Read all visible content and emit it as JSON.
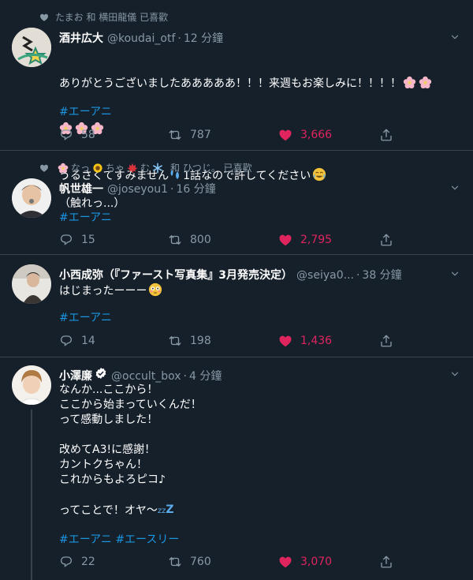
{
  "tweets": [
    {
      "social": "たまお 和 横田龍儀 已喜歡",
      "name": "酒井広大",
      "handle": "@koudai_otf",
      "time": "12 分鐘",
      "lines": [
        "ありがとうございましたあああああ！！！来週もお楽しみに！！！！",
        "",
        "うるさくてすみません",
        "1話なので許してください"
      ],
      "hashtags": "#エーアニ",
      "reply": "58",
      "retweet": "787",
      "like": "3,666"
    },
    {
      "social_a": "なっ",
      "social_b": "ちゃ",
      "social_c": "む",
      "social_d": "和 ひつじ。 已喜歡",
      "name": "帆世雄一",
      "handle": "@joseyou1",
      "time": "16 分鐘",
      "lines": [
        "（触れっ...）"
      ],
      "hashtags": "#エーアニ",
      "reply": "15",
      "retweet": "800",
      "like": "2,795"
    },
    {
      "name": "小西成弥（『ファースト写真集』3月発売決定）",
      "handle": "@seiya0...",
      "time": "38 分鐘",
      "lines": [
        "はじまったーーー"
      ],
      "hashtags": "#エーアニ",
      "reply": "14",
      "retweet": "198",
      "like": "1,436"
    },
    {
      "name": "小澤廉",
      "handle": "@occult_box",
      "time": "4 分鐘",
      "text": "なんか...ここから！\nここから始まっていくんだ！\nって感動しました！\n\n改めてA3!に感謝！\nカントクちゃん！\nこれからもよろピコ♪\n\nってことで！オヤ〜",
      "hashtags": "#エーアニ #エースリー",
      "reply": "22",
      "retweet": "760",
      "like": "3,070"
    }
  ],
  "colors": {
    "background": "#15202b",
    "muted": "#8899a6",
    "link": "#1b95e0",
    "like": "#e0245e",
    "border": "#38444d"
  }
}
